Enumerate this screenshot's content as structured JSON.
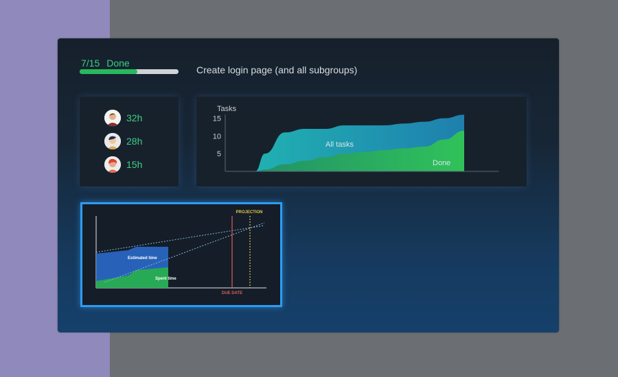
{
  "progress": {
    "count": "7/15",
    "status": "Done",
    "fraction": 0.58
  },
  "task": {
    "title": "Create login page (and all subgroups)"
  },
  "people": [
    {
      "hours": "32h",
      "avatar": "avatar-man-icon"
    },
    {
      "hours": "28h",
      "avatar": "avatar-person-icon"
    },
    {
      "hours": "15h",
      "avatar": "avatar-woman-icon"
    }
  ],
  "chart_data": [
    {
      "type": "area",
      "ylabel": "Tasks",
      "ylim": [
        0,
        18
      ],
      "yticks": [
        15,
        10,
        5
      ],
      "x": [
        0,
        3,
        4,
        6,
        8,
        10,
        12,
        14,
        16,
        18,
        20,
        22,
        24
      ],
      "series": [
        {
          "name": "All tasks",
          "values": [
            0,
            0,
            5,
            11,
            12,
            12,
            13,
            13,
            13,
            13.5,
            14,
            15,
            16
          ],
          "color": "#1fa9b2"
        },
        {
          "name": "Done",
          "values": [
            0,
            0,
            0.5,
            2,
            3,
            4,
            5,
            5.5,
            6,
            6.5,
            7,
            9,
            11.5
          ],
          "color": "#2bb45f"
        }
      ],
      "grid": false
    },
    {
      "type": "area",
      "labels": {
        "estimated": "Estimated time",
        "spent": "Spent time",
        "due": "DUE DATE",
        "projection": "PROJECTION"
      },
      "x": [
        0,
        2,
        2.5,
        3,
        4.5
      ],
      "series": [
        {
          "name": "Estimated time",
          "values": [
            5,
            5.5,
            6,
            6,
            6
          ],
          "color": "#2a6fd1"
        },
        {
          "name": "Spent time",
          "values": [
            1,
            1.8,
            2.6,
            2.7,
            3
          ],
          "color": "#28a955"
        }
      ],
      "colors": {
        "due": "#e05a5a",
        "projection": "#e2c54a",
        "projection_lines": "#8ab8d8"
      }
    }
  ]
}
